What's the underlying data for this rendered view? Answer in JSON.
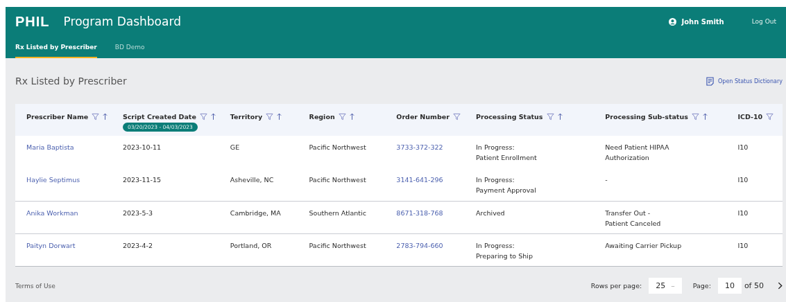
{
  "header": {
    "logo": "PHIL",
    "title": "Program Dashboard",
    "user": "John Smith",
    "logout": "Log Out"
  },
  "tabs": [
    {
      "label": "Rx Listed by Prescriber",
      "selected": true
    },
    {
      "label": "BD Demo",
      "selected": false
    }
  ],
  "page_title": "Rx Listed by Prescriber",
  "dictionary_link": "Open Status Dictionary",
  "table": {
    "columns": [
      {
        "label": "Prescriber Name",
        "filter": true,
        "sort": true
      },
      {
        "label": "Script Created Date",
        "filter": true,
        "sort": true,
        "filter_chip": "03/20/2023 - 04/03/2023"
      },
      {
        "label": "Territory",
        "filter": true,
        "sort": true
      },
      {
        "label": "Region",
        "filter": true,
        "sort": true
      },
      {
        "label": "Order Number",
        "filter": true,
        "sort": false
      },
      {
        "label": "Processing Status",
        "filter": true,
        "sort": true
      },
      {
        "label": "Processing Sub-status",
        "filter": true,
        "sort": true
      },
      {
        "label": "ICD-10",
        "filter": true,
        "sort": false
      }
    ],
    "rows": [
      {
        "cells": [
          "Maria Baptista",
          "2023-10-11",
          "GE",
          "Pacific Northwest",
          "3733-372-322",
          "In Progress:\nPatient Enrollment",
          "Need Patient HIPAA\nAuthorization",
          "I10"
        ]
      },
      {
        "cells": [
          "Haylie Septimus",
          "2023-11-15",
          "Asheville, NC",
          "Pacific Northwest",
          "3141-641-296",
          "In Progress:\nPayment Approval",
          "-",
          "I10"
        ]
      },
      {
        "cells": [
          "Anika Workman",
          "2023-5-3",
          "Cambridge, MA",
          "Southern Atlantic",
          "8671-318-768",
          "Archived",
          "Transfer Out -\nPatient Canceled",
          "I10"
        ]
      },
      {
        "cells": [
          "Paityn Dorwart",
          "2023-4-2",
          "Portland, OR",
          "Pacific Northwest",
          "2783-794-660",
          "In Progress:\nPreparing to Ship",
          "Awaiting Carrier Pickup",
          "I10"
        ]
      }
    ]
  },
  "footer": {
    "terms": "Terms of Use",
    "rows_label": "Rows per page:",
    "rows_value": "25",
    "rows_caret": "–",
    "page_label": "Page:",
    "page_value": "10",
    "page_total": "of 50"
  }
}
